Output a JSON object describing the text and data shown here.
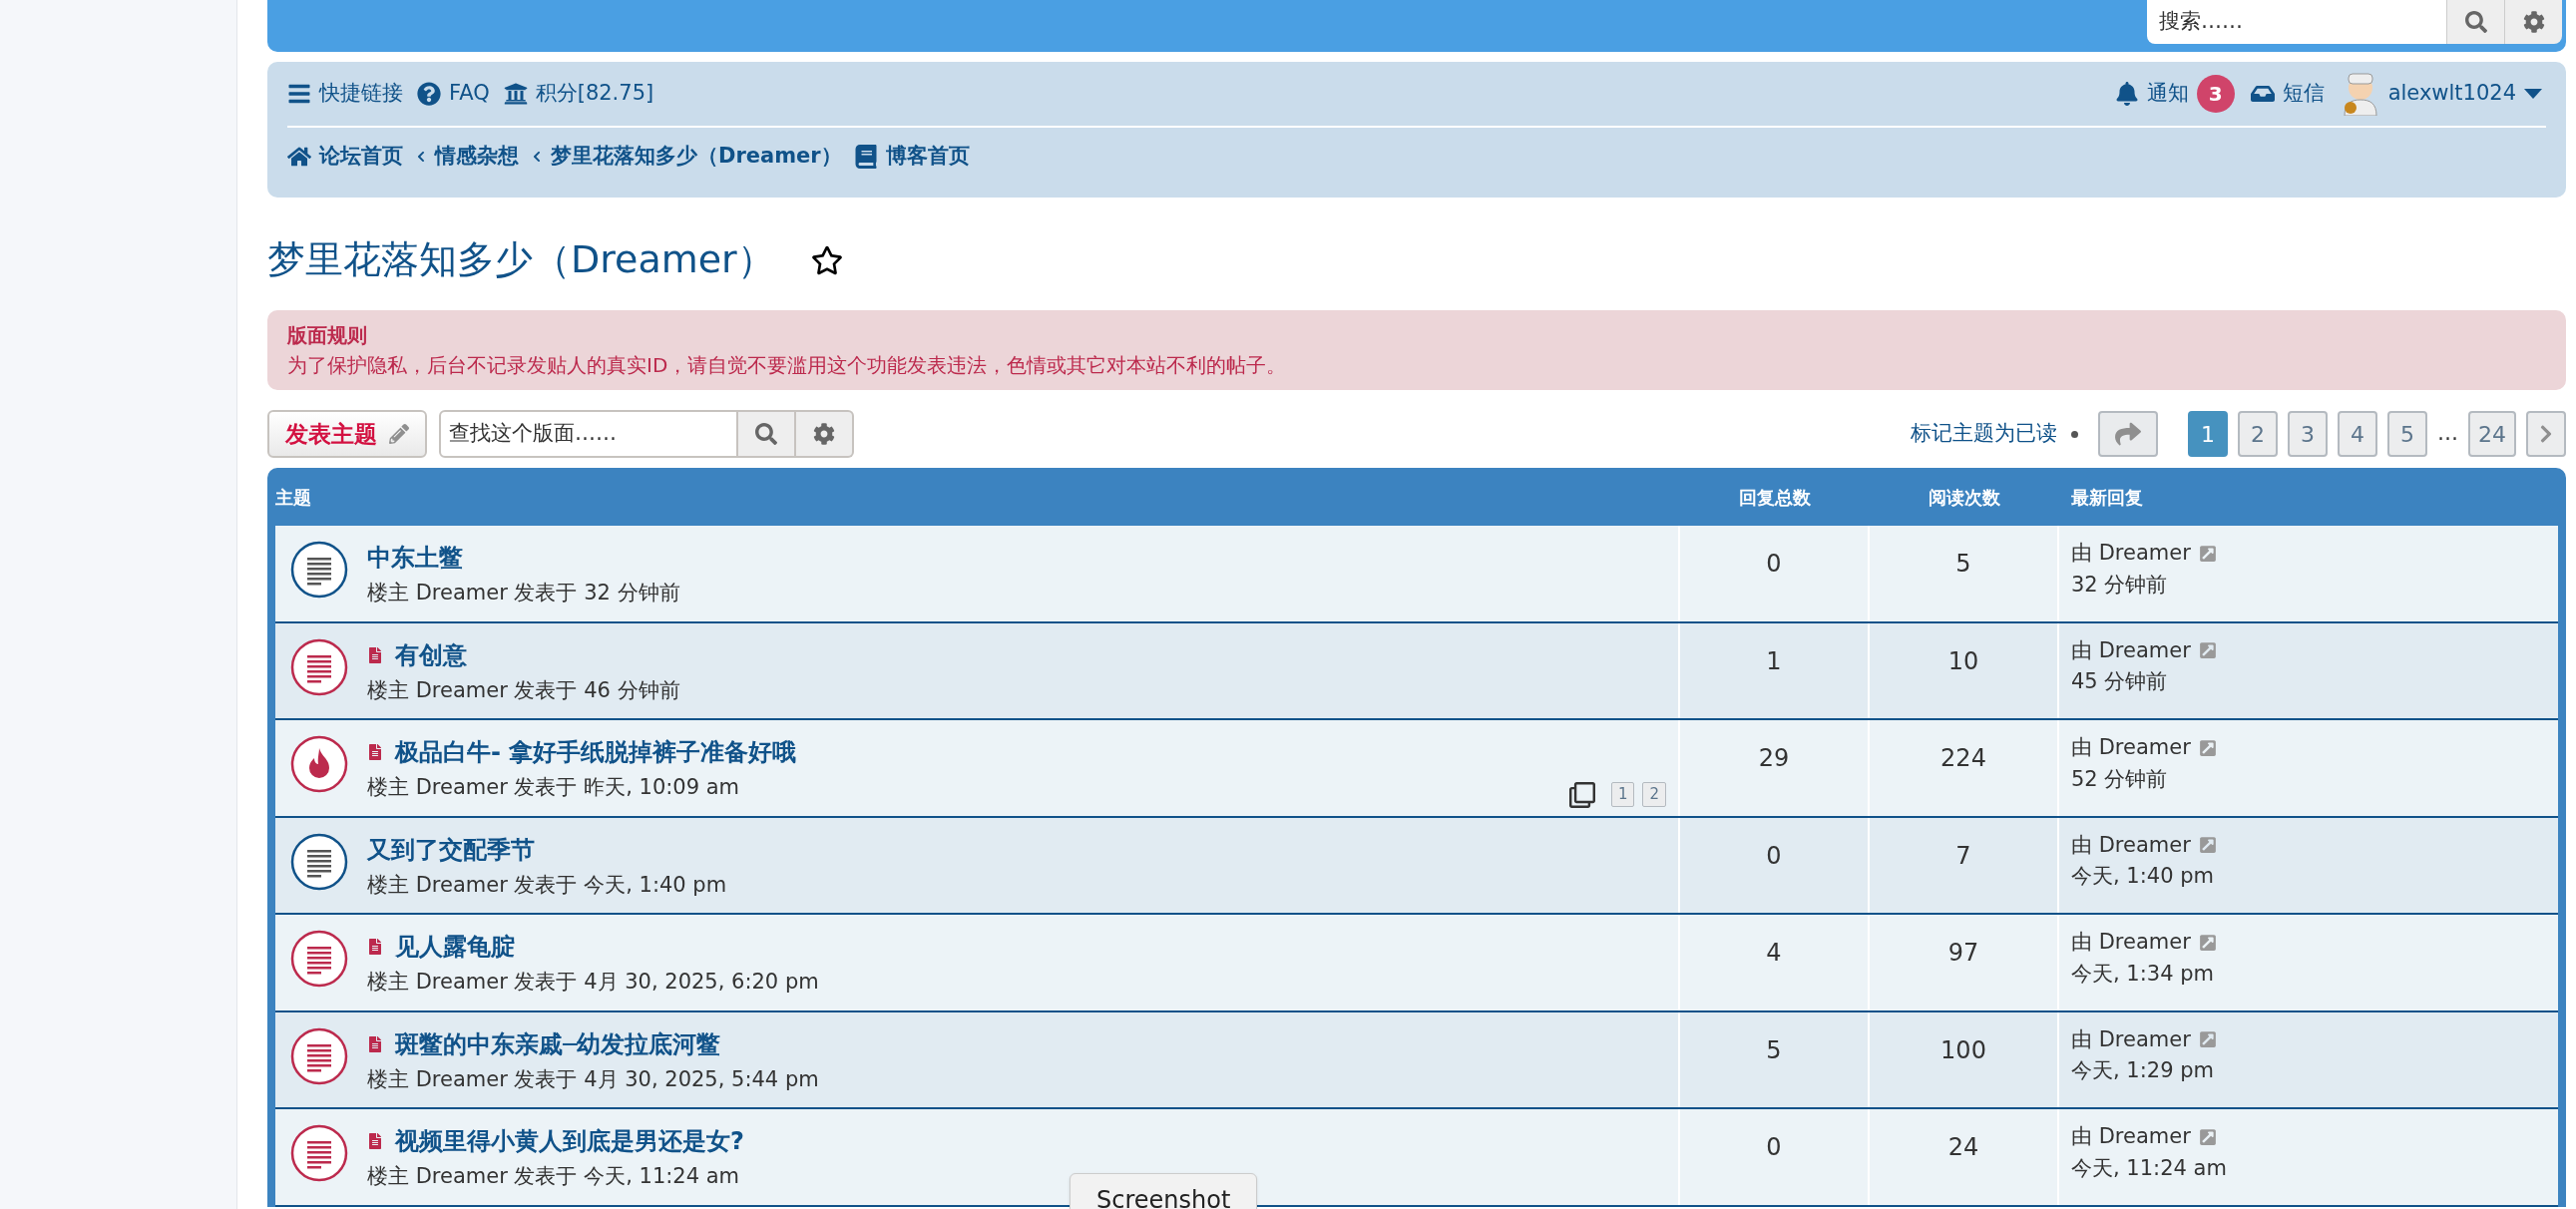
{
  "header_search": {
    "placeholder": "搜索……"
  },
  "quick_links": [
    {
      "kind": "menu",
      "label": "快捷链接"
    },
    {
      "kind": "faq",
      "label": "FAQ"
    },
    {
      "kind": "bank",
      "label": "积分[82.75]"
    }
  ],
  "user_links": {
    "notifications": {
      "label": "通知",
      "count": "3"
    },
    "messages": {
      "label": "短信"
    },
    "username": "alexwlt1024"
  },
  "breadcrumbs": [
    {
      "kind": "home",
      "label": "论坛首页"
    },
    {
      "kind": "crumb",
      "label": "情感杂想"
    },
    {
      "kind": "crumb",
      "label": "梦里花落知多少（Dreamer）"
    },
    {
      "kind": "blog",
      "label": "博客首页"
    }
  ],
  "forum_title": "梦里花落知多少（Dreamer）",
  "rules": {
    "title": "版面规则",
    "text": "为了保护隐私，后台不记录发贴人的真实ID，请自觉不要滥用这个功能发表违法，色情或其它对本站不利的帖子。"
  },
  "new_topic_button": "发表主题",
  "forum_search": {
    "placeholder": "查找这个版面……"
  },
  "mark_read": "标记主题为已读",
  "pagination": [
    {
      "label": "1",
      "selected": true
    },
    {
      "label": "2",
      "selected": false
    },
    {
      "label": "3",
      "selected": false
    },
    {
      "label": "4",
      "selected": false
    },
    {
      "label": "5",
      "selected": false
    },
    {
      "label": "24",
      "selected": false
    }
  ],
  "pagination_ellipsis": "…",
  "table": {
    "columns": [
      "主题",
      "回复总数",
      "阅读次数",
      "最新回复"
    ],
    "rows": [
      {
        "kind": "read",
        "unread": false,
        "title": "中东土鳖",
        "meta": "楼主 Dreamer 发表于 32 分钟前",
        "pages": [],
        "replies": "0",
        "views": "5",
        "last_by": "由 Dreamer",
        "last_time": "32 分钟前"
      },
      {
        "kind": "unread",
        "unread": true,
        "title": "有创意",
        "meta": "楼主 Dreamer 发表于 46 分钟前",
        "pages": [],
        "replies": "1",
        "views": "10",
        "last_by": "由 Dreamer",
        "last_time": "45 分钟前"
      },
      {
        "kind": "hot",
        "unread": true,
        "title": "极品白牛- 拿好手纸脱掉裤子准备好哦",
        "meta": "楼主 Dreamer 发表于 昨天, 10:09 am",
        "pages": [
          "1",
          "2"
        ],
        "replies": "29",
        "views": "224",
        "last_by": "由 Dreamer",
        "last_time": "52 分钟前"
      },
      {
        "kind": "read",
        "unread": false,
        "title": "又到了交配季节",
        "meta": "楼主 Dreamer 发表于 今天, 1:40 pm",
        "pages": [],
        "replies": "0",
        "views": "7",
        "last_by": "由 Dreamer",
        "last_time": "今天, 1:40 pm"
      },
      {
        "kind": "unread",
        "unread": true,
        "title": "见人露龟腚",
        "meta": "楼主 Dreamer 发表于 4月 30, 2025, 6:20 pm",
        "pages": [],
        "replies": "4",
        "views": "97",
        "last_by": "由 Dreamer",
        "last_time": "今天, 1:34 pm"
      },
      {
        "kind": "unread",
        "unread": true,
        "title": "斑鳖的中东亲戚─幼发拉底河鳖",
        "meta": "楼主 Dreamer 发表于 4月 30, 2025, 5:44 pm",
        "pages": [],
        "replies": "5",
        "views": "100",
        "last_by": "由 Dreamer",
        "last_time": "今天, 1:29 pm"
      },
      {
        "kind": "unread",
        "unread": true,
        "title": "视频里得小黄人到底是男还是女?",
        "meta": "楼主 Dreamer 发表于 今天, 11:24 am",
        "pages": [],
        "replies": "0",
        "views": "24",
        "last_by": "由 Dreamer",
        "last_time": "今天, 11:24 am"
      }
    ]
  },
  "tooltip": "Screenshot"
}
